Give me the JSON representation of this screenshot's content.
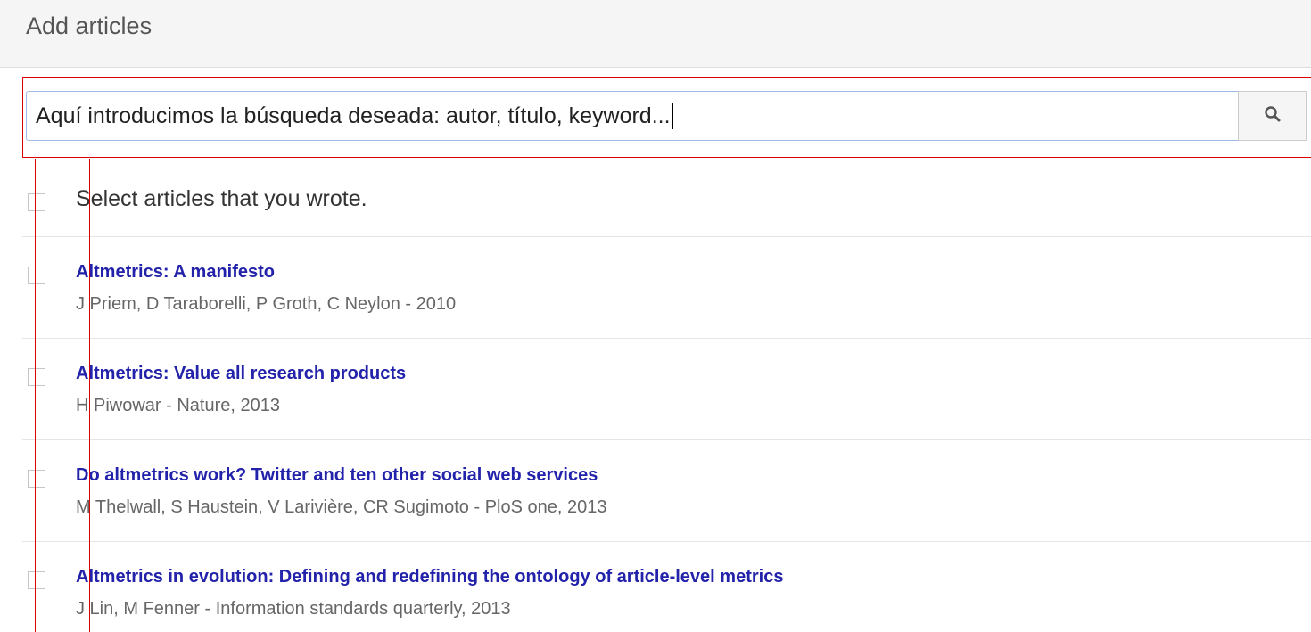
{
  "header": {
    "title": "Add articles"
  },
  "search": {
    "value": "Aquí introducimos la búsqueda deseada: autor, título, keyword...",
    "button_icon": "search-icon"
  },
  "select_all": {
    "label": "Select articles that you wrote."
  },
  "articles": [
    {
      "title": "Altmetrics: A manifesto",
      "meta": "J Priem, D Taraborelli, P Groth, C Neylon - 2010"
    },
    {
      "title": "Altmetrics: Value all research products",
      "meta": "H Piwowar - Nature, 2013"
    },
    {
      "title": "Do altmetrics work? Twitter and ten other social web services",
      "meta": "M Thelwall, S Haustein, V Larivière, CR Sugimoto - PloS one, 2013"
    },
    {
      "title": "Altmetrics in evolution: Defining and redefining the ontology of article-level metrics",
      "meta": "J Lin, M Fenner - Information standards quarterly, 2013"
    }
  ],
  "colors": {
    "link": "#2222aa",
    "annotation": "#e00000"
  }
}
